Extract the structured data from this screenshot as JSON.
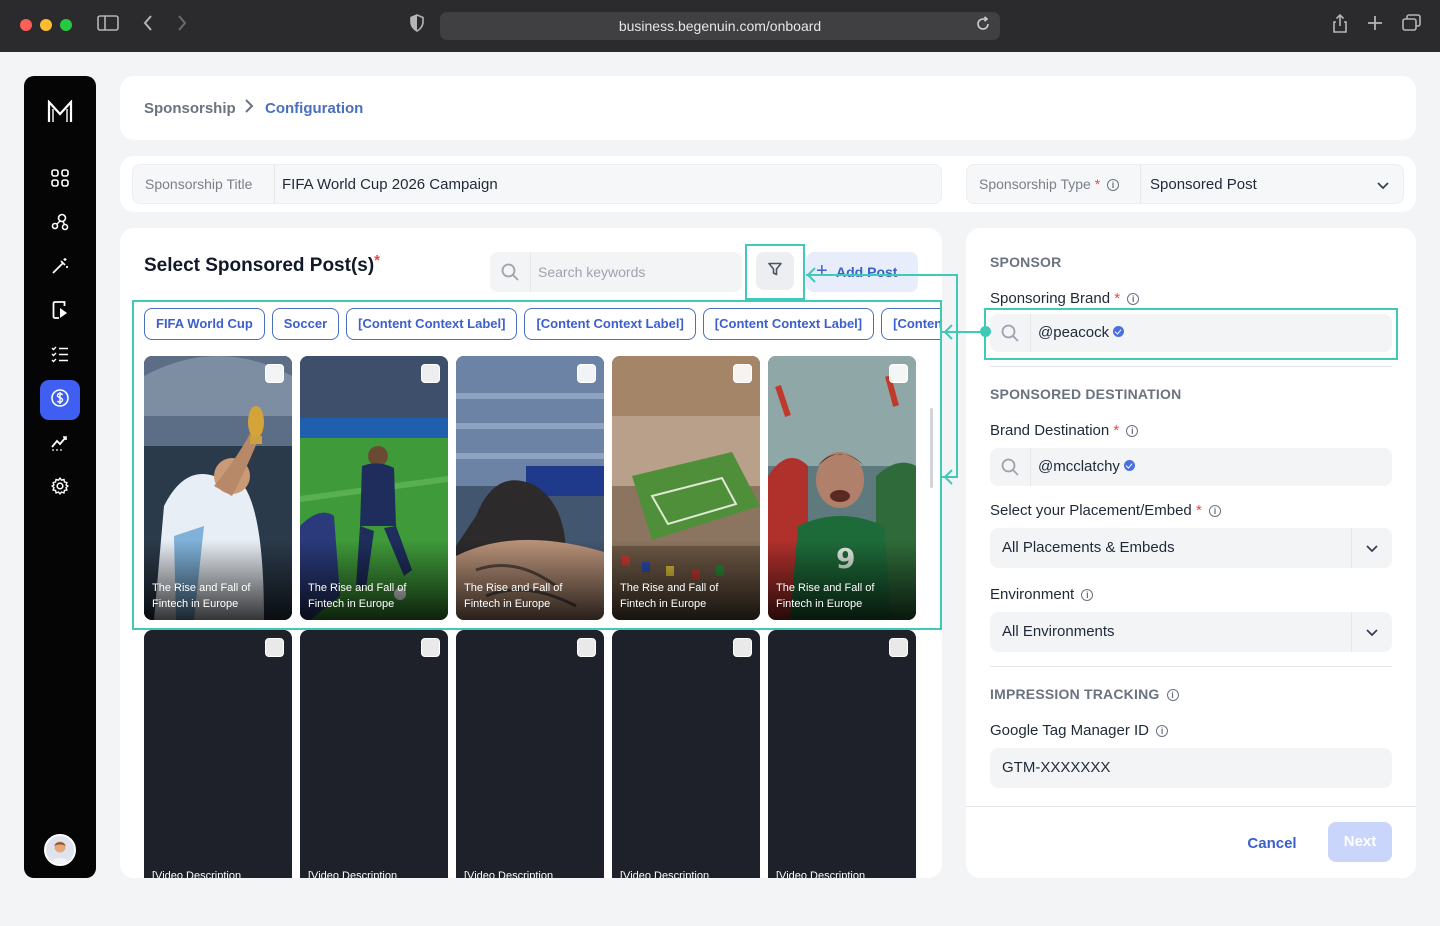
{
  "browser": {
    "url": "business.begenuin.com/onboard"
  },
  "sidebar": {
    "logo_text": "M",
    "items": [
      {
        "icon": "grid-icon"
      },
      {
        "icon": "users-network-icon"
      },
      {
        "icon": "magic-wand-icon"
      },
      {
        "icon": "device-play-icon"
      },
      {
        "icon": "checklist-icon"
      },
      {
        "icon": "dollar-icon",
        "active": true
      },
      {
        "icon": "analytics-icon"
      },
      {
        "icon": "gear-icon"
      }
    ],
    "active_color": "#3f5ff2"
  },
  "breadcrumb": {
    "parent": "Sponsorship",
    "current": "Configuration"
  },
  "title_bar": {
    "title_label": "Sponsorship Title",
    "title_value": "FIFA World Cup 2026 Campaign",
    "type_label": "Sponsorship Type",
    "type_required": "*",
    "type_value": "Sponsored Post"
  },
  "posts": {
    "heading": "Select Sponsored Post(s)",
    "required": "*",
    "search_placeholder": "Search keywords",
    "add_label": "Add Post",
    "tags": [
      "FIFA World Cup",
      "Soccer",
      "[Content Context Label]",
      "[Content Context Label]",
      "[Content Context Label]",
      "[Content Context Label]"
    ],
    "row1_captions": [
      "The Rise and Fall of Fintech in Europe",
      "The Rise and Fall of Fintech in Europe",
      "The Rise and Fall of Fintech in Europe",
      "The Rise and Fall of Fintech in Europe",
      "The Rise and Fall of Fintech in Europe"
    ],
    "row2_captions": [
      "[Video Description",
      "[Video Description",
      "[Video Description",
      "[Video Description",
      "[Video Description"
    ]
  },
  "sponsor_panel": {
    "sponsor_heading": "SPONSOR",
    "brand_label": "Sponsoring Brand",
    "brand_required": "*",
    "brand_value": "@peacock",
    "destination_heading": "SPONSORED DESTINATION",
    "destination_label": "Brand Destination",
    "destination_required": "*",
    "destination_value": "@mcclatchy",
    "placement_label": "Select your Placement/Embed",
    "placement_required": "*",
    "placement_value": "All Placements & Embeds",
    "environment_label": "Environment",
    "environment_value": "All Environments",
    "tracking_heading": "IMPRESSION TRACKING",
    "gtm_label": "Google Tag Manager ID",
    "gtm_value": "GTM-XXXXXXX",
    "cancel_label": "Cancel",
    "next_label": "Next"
  },
  "colors": {
    "accent": "#3b5fcc",
    "highlight": "#40c9b6",
    "next_disabled": "#c9d5fb"
  }
}
